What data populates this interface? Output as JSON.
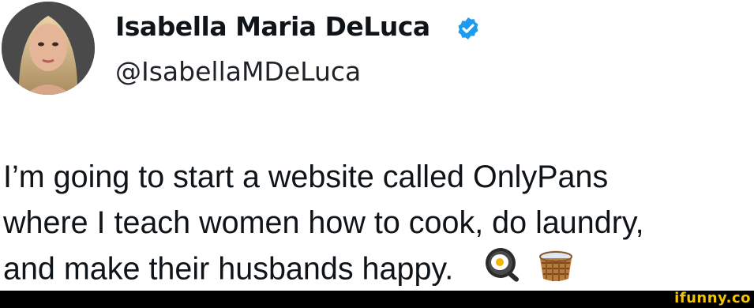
{
  "tweet": {
    "author_name": "Isabella Maria DeLuca",
    "handle": "@IsabellaMDeLuca",
    "verified_icon": "verified-badge-icon",
    "body_lines": [
      "I’m going to start a website called OnlyPans",
      "where I teach women how to cook, do laundry,",
      "and make their husbands happy."
    ],
    "emojis": [
      "frying-pan-egg-icon",
      "laundry-basket-icon"
    ]
  },
  "footer": {
    "watermark": "ifunny.co"
  },
  "colors": {
    "verified_blue": "#1d9bf0",
    "text": "#0f1419",
    "footer_bg": "#000000",
    "watermark_yellow": "#f4c400"
  }
}
